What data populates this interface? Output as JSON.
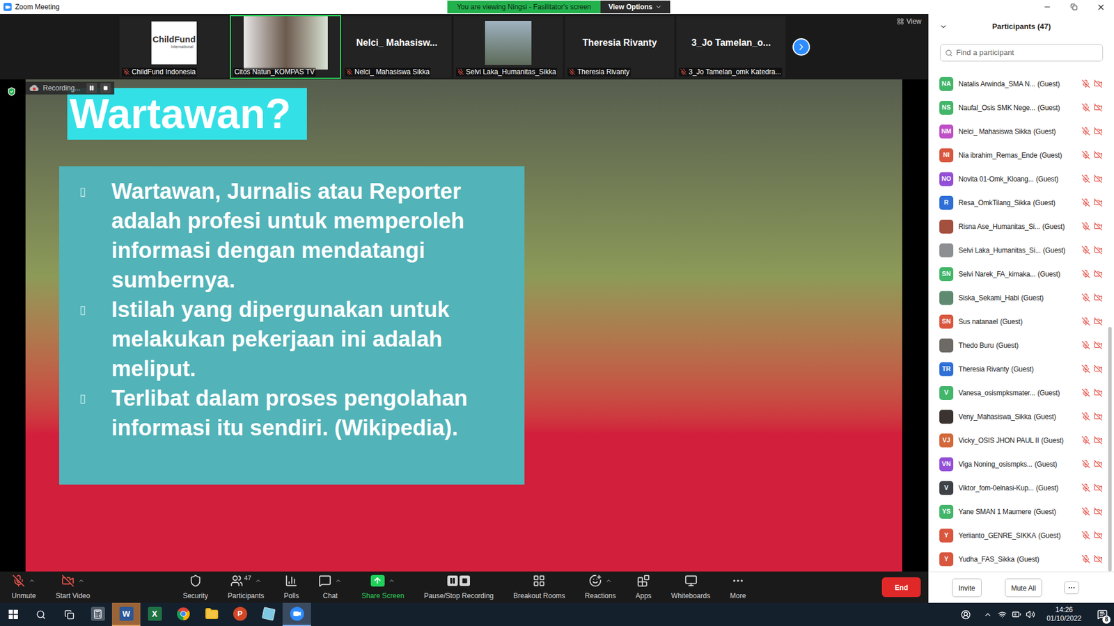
{
  "window": {
    "title": "Zoom Meeting",
    "banner": "You are viewing Ningsi - Fasilitator's screen",
    "view_options": "View Options"
  },
  "gallery": {
    "view_label": "View",
    "tiles": [
      {
        "name": "ChildFund Indonesia",
        "kind": "logo",
        "logo_text": "ChildFund",
        "logo_sub": "International",
        "muted": true,
        "speaking": false
      },
      {
        "name": "Citos Natun_KOMPAS TV",
        "kind": "video",
        "muted": false,
        "speaking": true
      },
      {
        "name": "Nelci_ Mahasiswa Sikka",
        "kind": "name",
        "display": "Nelci_ Mahasisw...",
        "muted": true,
        "speaking": false
      },
      {
        "name": "Selvi Laka_Humanitas_Sikka",
        "kind": "photo",
        "muted": true,
        "speaking": false
      },
      {
        "name": "Theresia Rivanty",
        "kind": "name",
        "display": "Theresia Rivanty",
        "muted": true,
        "speaking": false
      },
      {
        "name": "3_Jo Tamelan_omk Katedra...",
        "kind": "name",
        "display": "3_Jo Tamelan_o...",
        "muted": true,
        "speaking": false
      }
    ]
  },
  "recording": {
    "label": "Recording...",
    "paused": false
  },
  "slide": {
    "title": "Wartawan?",
    "bullet": "▯",
    "bullets": [
      "Wartawan, Jurnalis atau Reporter adalah profesi untuk memperoleh informasi dengan mendatangi sumbernya.",
      "Istilah yang dipergunakan untuk melakukan pekerjaan ini adalah meliput.",
      "Terlibat dalam proses pengolahan informasi itu sendiri. (Wikipedia)."
    ]
  },
  "toolbar": {
    "items": [
      {
        "label": "Unmute",
        "kind": "mic",
        "caret": true
      },
      {
        "label": "Start Video",
        "kind": "video",
        "caret": true
      },
      {
        "label": "Security",
        "kind": "security",
        "caret": false
      },
      {
        "label": "Participants",
        "kind": "participants",
        "badge": "47",
        "caret": true
      },
      {
        "label": "Polls",
        "kind": "polls",
        "caret": false
      },
      {
        "label": "Chat",
        "kind": "chat",
        "caret": true
      },
      {
        "label": "Share Screen",
        "kind": "share",
        "caret": true
      },
      {
        "label": "Pause/Stop Recording",
        "kind": "record",
        "caret": false
      },
      {
        "label": "Breakout Rooms",
        "kind": "breakout",
        "caret": false
      },
      {
        "label": "Reactions",
        "kind": "reactions",
        "caret": true
      },
      {
        "label": "Apps",
        "kind": "apps",
        "caret": false
      },
      {
        "label": "Whiteboards",
        "kind": "whiteboard",
        "caret": false
      },
      {
        "label": "More",
        "kind": "more",
        "caret": false
      }
    ],
    "end": "End"
  },
  "participants_panel": {
    "title": "Participants (47)",
    "search_placeholder": "Find a participant",
    "participants": [
      {
        "name": "Natalis Arwinda_SMA N...",
        "role": "(Guest)",
        "kind": "initials",
        "initials": "NA",
        "color": "#43b66a",
        "muted": true,
        "video_off": true
      },
      {
        "name": "Naufal_Osis SMK Nege...",
        "role": "(Guest)",
        "kind": "initials",
        "initials": "NS",
        "color": "#43b66a",
        "muted": true,
        "video_off": true
      },
      {
        "name": "Nelci_ Mahasiswa Sikka",
        "role": "(Guest)",
        "kind": "initials",
        "initials": "NM",
        "color": "#bf4fc5",
        "muted": true,
        "video_off": true
      },
      {
        "name": "Nia ibrahim_Remas_Ende",
        "role": "(Guest)",
        "kind": "initials",
        "initials": "NI",
        "color": "#d9573f",
        "muted": true,
        "video_off": true
      },
      {
        "name": "Novita 01-Omk_Kloang...",
        "role": "(Guest)",
        "kind": "initials",
        "initials": "NO",
        "color": "#9350d6",
        "muted": true,
        "video_off": true
      },
      {
        "name": "Resa_OmkTilang_Sikka",
        "role": "(Guest)",
        "kind": "initials",
        "initials": "R",
        "color": "#2f6fd6",
        "muted": true,
        "video_off": true
      },
      {
        "name": "Risna Ase_Humanitas_Si...",
        "role": "(Guest)",
        "kind": "photo",
        "color": "#a4503e",
        "muted": true,
        "video_off": true
      },
      {
        "name": "Selvi Laka_Humanitas_Si...",
        "role": "(Guest)",
        "kind": "photo",
        "color": "#8d8f92",
        "muted": true,
        "video_off": true
      },
      {
        "name": "Selvi Narek_FA_kimaka...",
        "role": "(Guest)",
        "kind": "initials",
        "initials": "SN",
        "color": "#43b66a",
        "muted": true,
        "video_off": true
      },
      {
        "name": "Siska_Sekami_Habi",
        "role": "(Guest)",
        "kind": "photo",
        "color": "#5f8a70",
        "muted": true,
        "video_off": true
      },
      {
        "name": "Sus natanael",
        "role": "(Guest)",
        "kind": "initials",
        "initials": "SN",
        "color": "#d9573f",
        "muted": true,
        "video_off": true
      },
      {
        "name": "Thedo Buru",
        "role": "(Guest)",
        "kind": "photo",
        "color": "#6d6a66",
        "muted": true,
        "video_off": true
      },
      {
        "name": "Theresia Rivanty",
        "role": "(Guest)",
        "kind": "initials",
        "initials": "TR",
        "color": "#2f6fd6",
        "muted": true,
        "video_off": true
      },
      {
        "name": "Vanesa_osismpksmater...",
        "role": "(Guest)",
        "kind": "initials",
        "initials": "V",
        "color": "#43b66a",
        "muted": true,
        "video_off": true
      },
      {
        "name": "Veny_Mahasiswa_Sikka",
        "role": "(Guest)",
        "kind": "photo",
        "color": "#3b3330",
        "muted": true,
        "video_off": true
      },
      {
        "name": "Vicky_OSIS JHON PAUL II",
        "role": "(Guest)",
        "kind": "initials",
        "initials": "VJ",
        "color": "#d2693a",
        "muted": true,
        "video_off": true
      },
      {
        "name": "Viga Noning_osismpks...",
        "role": "(Guest)",
        "kind": "initials",
        "initials": "VN",
        "color": "#9350d6",
        "muted": true,
        "video_off": true
      },
      {
        "name": "Viktor_fom-0elnasi-Kup...",
        "role": "(Guest)",
        "kind": "initials",
        "initials": "V",
        "color": "#3e4246",
        "muted": true,
        "video_off": true
      },
      {
        "name": "Yane SMAN 1 Maumere",
        "role": "(Guest)",
        "kind": "initials",
        "initials": "YS",
        "color": "#43b66a",
        "muted": true,
        "video_off": true
      },
      {
        "name": "Yeriianto_GENRE_SIKKA",
        "role": "(Guest)",
        "kind": "initials",
        "initials": "Y",
        "color": "#d9573f",
        "muted": true,
        "video_off": true
      },
      {
        "name": "Yudha_FAS_Sikka",
        "role": "(Guest)",
        "kind": "initials",
        "initials": "Y",
        "color": "#d9573f",
        "muted": true,
        "video_off": true
      }
    ],
    "scroll": {
      "offset": 0.51,
      "thumb": 0.49
    },
    "buttons": [
      "Invite",
      "Mute All"
    ]
  },
  "taskbar": {
    "apps": [
      {
        "kind": "calculator",
        "active": false,
        "flashing": false
      },
      {
        "kind": "word",
        "glyph": "W",
        "active": false,
        "flashing": true
      },
      {
        "kind": "excel",
        "glyph": "X",
        "active": false,
        "flashing": false
      },
      {
        "kind": "chrome",
        "active": false,
        "flashing": false
      },
      {
        "kind": "explorer",
        "active": false,
        "flashing": false
      },
      {
        "kind": "powerpoint",
        "glyph": "P",
        "active": false,
        "flashing": false
      },
      {
        "kind": "app",
        "active": false,
        "flashing": false
      },
      {
        "kind": "zoom",
        "active": true,
        "flashing": false
      }
    ],
    "time": "14:26",
    "date": "01/10/2022",
    "notifications": "8"
  }
}
